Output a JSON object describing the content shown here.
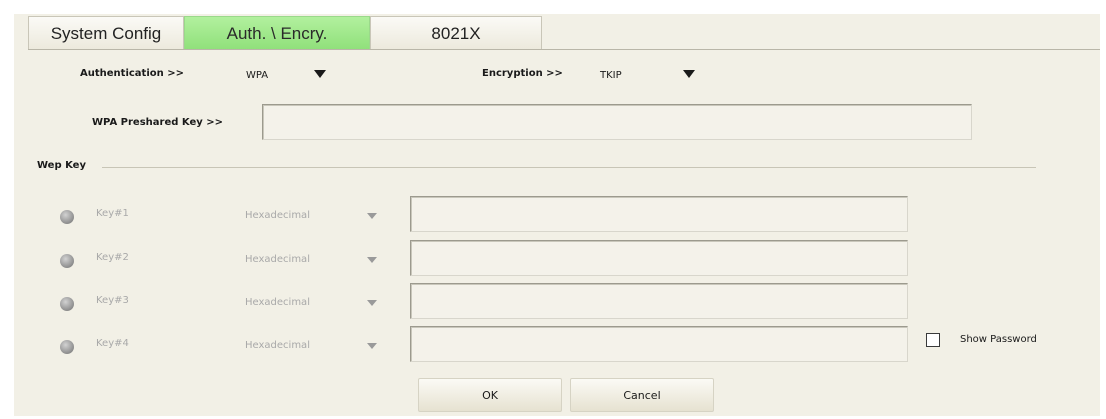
{
  "tabs": [
    {
      "label": "System Config"
    },
    {
      "label": "Auth. \\ Encry."
    },
    {
      "label": "8021X"
    }
  ],
  "active_tab": "Auth. \\ Encry.",
  "authentication": {
    "label": "Authentication >>",
    "value": "WPA"
  },
  "encryption": {
    "label": "Encryption >>",
    "value": "TKIP"
  },
  "wpa_key": {
    "label": "WPA Preshared Key >>",
    "value": ""
  },
  "wep": {
    "group_label": "Wep Key",
    "keys": [
      {
        "label": "Key#1",
        "format": "Hexadecimal",
        "value": ""
      },
      {
        "label": "Key#2",
        "format": "Hexadecimal",
        "value": ""
      },
      {
        "label": "Key#3",
        "format": "Hexadecimal",
        "value": ""
      },
      {
        "label": "Key#4",
        "format": "Hexadecimal",
        "value": ""
      }
    ]
  },
  "show_password": {
    "label": "Show Password",
    "checked": false
  },
  "buttons": {
    "ok": "OK",
    "cancel": "Cancel"
  },
  "colors": {
    "active_tab": "#9fe88b",
    "panel": "#f2f0e6",
    "disabled_text": "#a9a9a9"
  }
}
